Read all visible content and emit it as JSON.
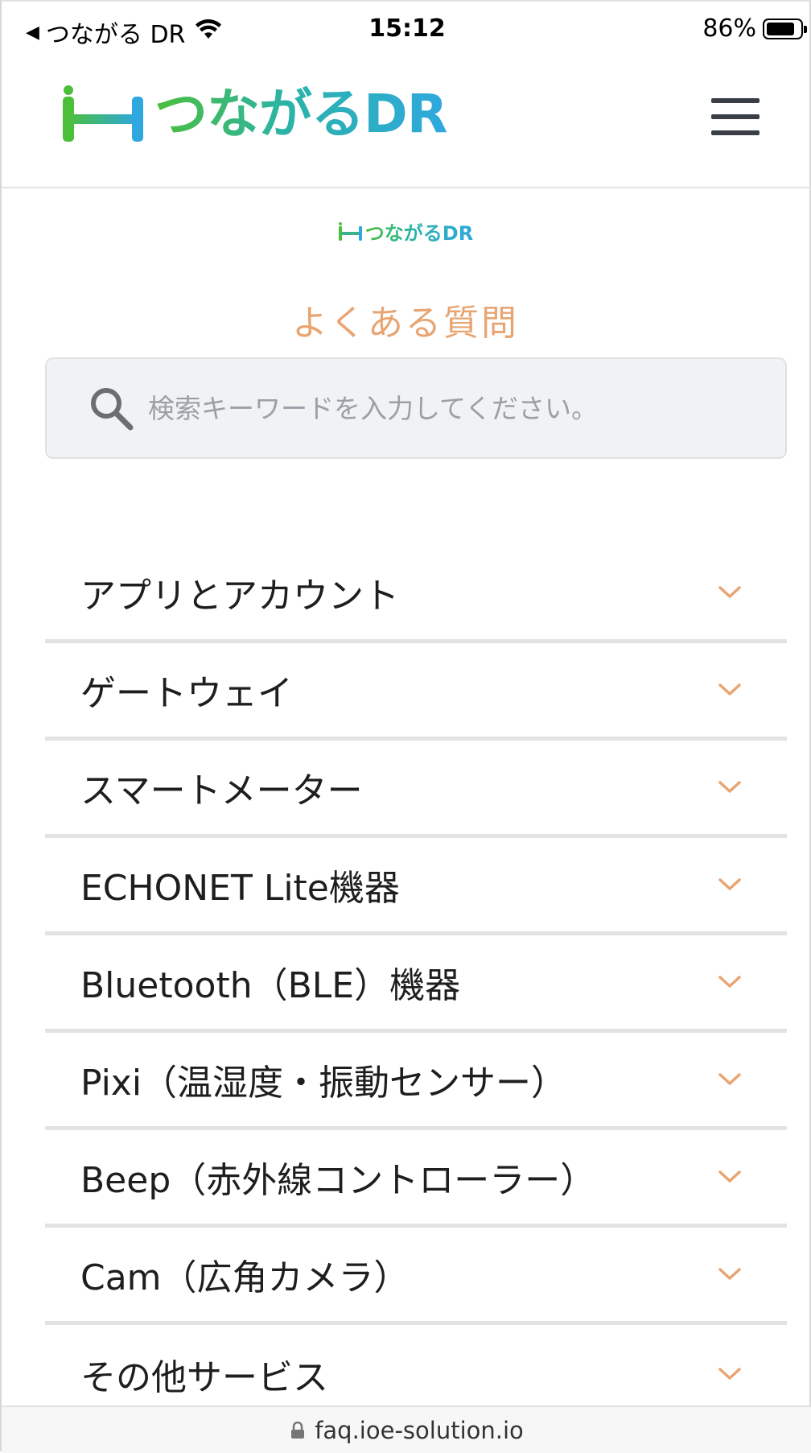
{
  "status_bar": {
    "back_app": "つながる DR",
    "time": "15:12",
    "battery": "86%",
    "battery_level": 0.86
  },
  "header": {
    "logo_text": "つながるDR",
    "menu_icon": "hamburger-menu-icon"
  },
  "intro": {
    "logo_text": "つながるDR",
    "title": "よくある質問"
  },
  "search": {
    "placeholder": "検索キーワードを入力してください。",
    "value": "",
    "icon": "search-icon"
  },
  "categories": [
    {
      "label": "アプリとアカウント"
    },
    {
      "label": "ゲートウェイ"
    },
    {
      "label": "スマートメーター"
    },
    {
      "label": "ECHONET Lite機器"
    },
    {
      "label": "Bluetooth（BLE）機器"
    },
    {
      "label": "Pixi（温湿度・振動センサー）"
    },
    {
      "label": "Beep（赤外線コントローラー）"
    },
    {
      "label": "Cam（広角カメラ）"
    },
    {
      "label": "その他サービス"
    }
  ],
  "url_bar": {
    "url": "faq.ioe-solution.io"
  },
  "colors": {
    "accent": "#e8a572",
    "brand_green": "#4cbf3a",
    "brand_blue": "#2ea8df",
    "divider": "#e3e3e3"
  }
}
